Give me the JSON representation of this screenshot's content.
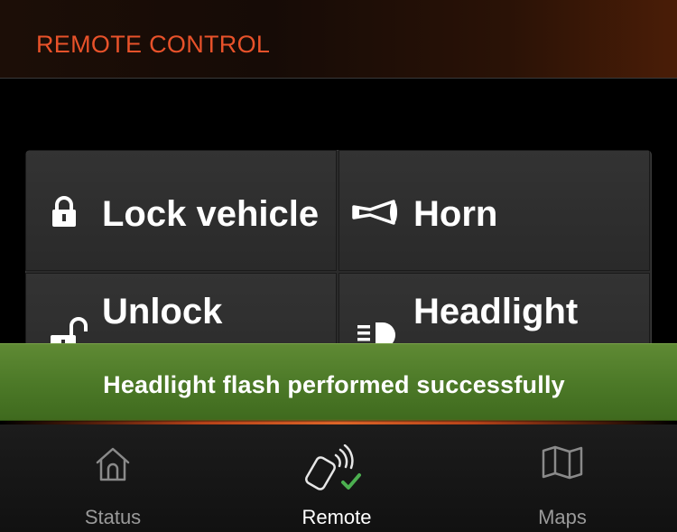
{
  "header": {
    "title": "REMOTE CONTROL"
  },
  "controls": [
    {
      "label": "Lock vehicle",
      "icon": "lock-icon"
    },
    {
      "label": "Horn",
      "icon": "horn-icon"
    },
    {
      "label": "Unlock",
      "icon": "unlock-icon"
    },
    {
      "label": "Headlight",
      "icon": "headlight-icon"
    }
  ],
  "toast": {
    "message": "Headlight flash performed successfully"
  },
  "tabs": [
    {
      "label": "Status",
      "icon": "home-icon",
      "active": false
    },
    {
      "label": "Remote",
      "icon": "remote-key-icon",
      "active": true
    },
    {
      "label": "Maps",
      "icon": "map-icon",
      "active": false
    }
  ],
  "colors": {
    "accent": "#e8522a",
    "success": "#4d7a28",
    "check": "#4caf50"
  }
}
